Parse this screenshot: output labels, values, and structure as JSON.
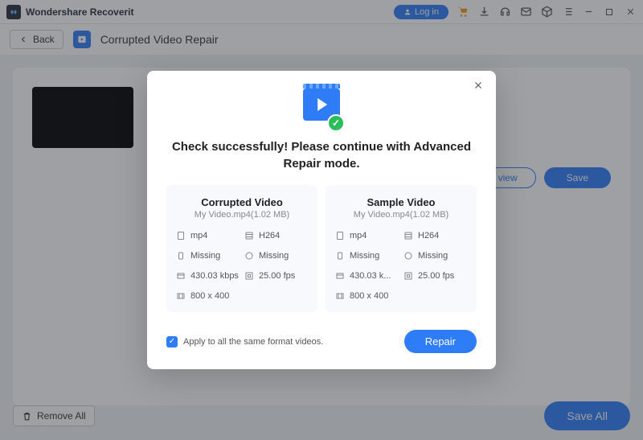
{
  "titlebar": {
    "app_name": "Wondershare Recoverit",
    "login_label": "Log in"
  },
  "toolbar": {
    "back_label": "Back",
    "page_title": "Corrupted Video Repair"
  },
  "bg_buttons": {
    "preview_label": "view",
    "save_label": "Save"
  },
  "footer": {
    "remove_all_label": "Remove All",
    "save_all_label": "Save All"
  },
  "dialog": {
    "message": "Check successfully! Please continue with Advanced Repair mode.",
    "apply_all_label": "Apply to all the same format videos.",
    "repair_label": "Repair",
    "panels": [
      {
        "title": "Corrupted Video",
        "subtitle": "My Video.mp4(1.02   MB)",
        "stats": {
          "format": "mp4",
          "codec": "H264",
          "audio": "Missing",
          "audio_codec": "Missing",
          "bitrate": "430.03 kbps",
          "fps": "25.00 fps",
          "resolution": "800 x 400"
        }
      },
      {
        "title": "Sample Video",
        "subtitle": "My Video.mp4(1.02   MB)",
        "stats": {
          "format": "mp4",
          "codec": "H264",
          "audio": "Missing",
          "audio_codec": "Missing",
          "bitrate": "430.03 k...",
          "fps": "25.00 fps",
          "resolution": "800 x 400"
        }
      }
    ]
  }
}
